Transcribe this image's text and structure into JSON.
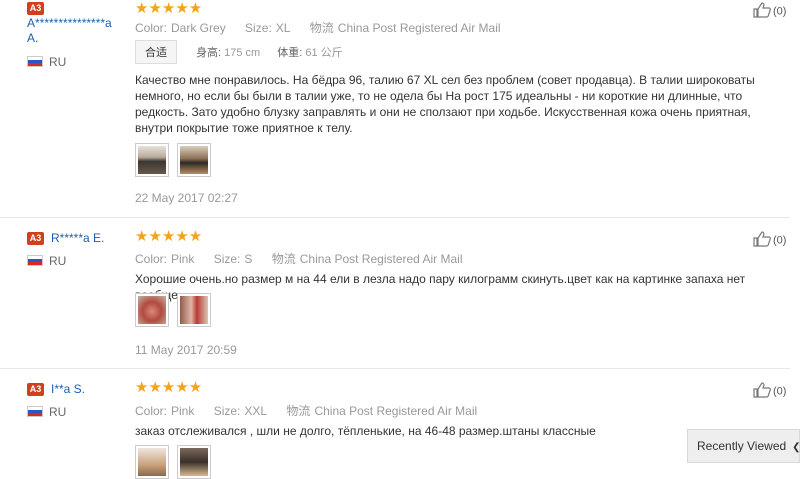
{
  "reviews": [
    {
      "badge": "A3",
      "name": "A***************a A.",
      "country": "RU",
      "stars": "★★★★★",
      "attrs": [
        {
          "k": "Color:",
          "v": "Dark Grey"
        },
        {
          "k": "Size:",
          "v": "XL"
        },
        {
          "k": "物流",
          "v": "China Post Registered Air Mail"
        }
      ],
      "fit": {
        "btn": "合适",
        "height_k": "身高:",
        "height_v": "175 cm",
        "weight_k": "体重:",
        "weight_v": "61 公斤"
      },
      "text": "Качество мне понравилось. На бёдра 96, талию 67 XL сел без проблем (совет продавца). В талии широковаты немного, но если бы были в талии уже, то не одела бы На рост 175 идеальны - ни короткие ни длинные, что редкость. Зато удобно блузку заправлять и они не сползают при ходьбе. Искусственная кожа очень приятная, внутри покрытие тоже приятное к телу.",
      "date": "22 May 2017 02:27",
      "helpful": "(0)"
    },
    {
      "badge": "A3",
      "name": "R*****a E.",
      "country": "RU",
      "stars": "★★★★★",
      "attrs": [
        {
          "k": "Color:",
          "v": "Pink"
        },
        {
          "k": "Size:",
          "v": "S"
        },
        {
          "k": "物流",
          "v": "China Post Registered Air Mail"
        }
      ],
      "text": "Хорошие очень.но размер м на 44 ели в лезла надо пару килограмм скинуть.цвет как на картинке запаха нет вообще.",
      "date": "11 May 2017 20:59",
      "helpful": "(0)"
    },
    {
      "badge": "A3",
      "name": "I**a S.",
      "country": "RU",
      "stars": "★★★★★",
      "attrs": [
        {
          "k": "Color:",
          "v": "Pink"
        },
        {
          "k": "Size:",
          "v": "XXL"
        },
        {
          "k": "物流",
          "v": "China Post Registered Air Mail"
        }
      ],
      "text": "заказ отслеживался , шли не долго, тёпленькие, на 46-48 размер.штаны классные",
      "helpful": "(0)"
    }
  ],
  "recently_viewed": "Recently Viewed",
  "colors": {
    "badge": "#d0401b",
    "star": "#f6a417",
    "name": "#1a5fb4"
  }
}
